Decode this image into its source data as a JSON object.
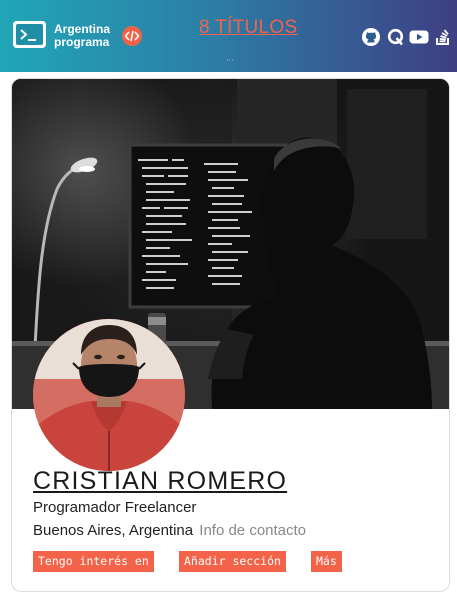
{
  "header": {
    "brand_line1": "Argentina",
    "brand_line2": "programa",
    "titles_link": "8 TÍTULOS",
    "icons": [
      "terminal-icon",
      "code-icon",
      "github-icon",
      "quora-icon",
      "youtube-icon",
      "stackoverflow-icon"
    ]
  },
  "profile": {
    "name": "CRISTIAN ROMERO",
    "role": "Programador Freelancer",
    "location": "Buenos Aires, Argentina",
    "contact_link": "Info de contacto",
    "buttons": [
      "Tengo interés en",
      "Añadir sección",
      "Más"
    ]
  },
  "colors": {
    "accent": "#f2634a",
    "header_gradient_start": "#21a6b7",
    "header_gradient_end": "#3e3f83"
  }
}
